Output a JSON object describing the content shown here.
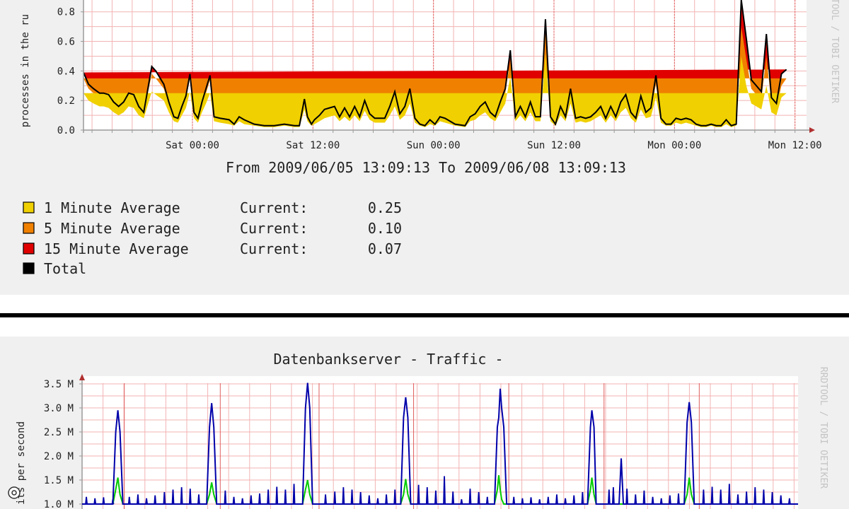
{
  "colors": {
    "panel_bg": "#f0f0f0",
    "plot_bg": "#ffffff",
    "grid": "#f3b3b3",
    "axis": "#9a9a9a",
    "arrow": "#b03030",
    "text": "#222222",
    "watermark": "#c4c4c4",
    "divider": "#000000",
    "load_1min": "#f0d000",
    "load_5min": "#f08000",
    "load_15min": "#e00000",
    "load_total": "#000000",
    "traffic_out": "#0000aa",
    "traffic_in": "#00cc00"
  },
  "load_panel": {
    "ylabel_visible": "processes in the ru",
    "watermark": "RRDTOOL / TOBI OETIKER",
    "period_text": "From 2009/06/05 13:09:13 To 2009/06/08 13:09:13",
    "legend": [
      {
        "label": "1 Minute Average",
        "current_label": "Current:",
        "current_value": "0.25",
        "color": "#f0d000"
      },
      {
        "label": "5 Minute Average",
        "current_label": "Current:",
        "current_value": "0.10",
        "color": "#f08000"
      },
      {
        "label": "15 Minute Average",
        "current_label": "Current:",
        "current_value": "0.07",
        "color": "#e00000"
      },
      {
        "label": "Total",
        "current_label": "",
        "current_value": "",
        "color": "#000000"
      }
    ]
  },
  "traffic_panel": {
    "title": "Datenbankserver - Traffic -",
    "ylabel_visible": "its per second",
    "watermark": "RRDTOOL / TOBI OETIKER"
  },
  "chart_data": [
    {
      "type": "area",
      "xlabel": "",
      "ylabel": "processes in the ru",
      "x_ticks": [
        "Sat 00:00",
        "Sat 12:00",
        "Sun 00:00",
        "Sun 12:00",
        "Mon 00:00",
        "Mon 12:00"
      ],
      "x_tick_hours": [
        10.85,
        22.85,
        34.85,
        46.85,
        58.85,
        70.85
      ],
      "xlim_hours": [
        0,
        72
      ],
      "y_ticks": [
        "0.0",
        "0.2",
        "0.4",
        "0.6",
        "0.8"
      ],
      "ylim": [
        0,
        0.88
      ],
      "x_hours": [
        0,
        0.5,
        1,
        1.6,
        2,
        2.5,
        3,
        3.5,
        4,
        4.5,
        5,
        5.5,
        6,
        6.8,
        7.2,
        8,
        8.5,
        9,
        9.4,
        9.8,
        10.2,
        10.6,
        11,
        11.4,
        11.8,
        12.2,
        12.6,
        13,
        13.6,
        14.5,
        15,
        15.5,
        16,
        17,
        18,
        19,
        20,
        21,
        21.5,
        22,
        22.3,
        22.7,
        23,
        23.5,
        24,
        24.5,
        25,
        25.5,
        26,
        26.5,
        27,
        27.5,
        28,
        28.5,
        29,
        29.5,
        30,
        30.5,
        31,
        31.5,
        32,
        32.5,
        33,
        33.5,
        34,
        34.5,
        35,
        35.5,
        36,
        37,
        38,
        38.5,
        39,
        39.5,
        40,
        40.5,
        41,
        41.5,
        42,
        42.5,
        43,
        43.5,
        44,
        44.5,
        45,
        45.5,
        46,
        46.5,
        47,
        47.5,
        48,
        48.5,
        49,
        49.5,
        50,
        50.5,
        51,
        51.5,
        52,
        52.5,
        53,
        53.5,
        54,
        54.5,
        55,
        55.5,
        56,
        56.5,
        57,
        57.5,
        58,
        58.5,
        59,
        59.5,
        60,
        60.5,
        61,
        61.5,
        62,
        62.5,
        63,
        63.5,
        64,
        64.5,
        65,
        65.5,
        66,
        66.5,
        67,
        67.5,
        68,
        68.5,
        69,
        69.5,
        70,
        70.5,
        71,
        71.5,
        72
      ],
      "series": [
        {
          "name": "1 Minute Average",
          "values": [
            0.25,
            0.2,
            0.18,
            0.16,
            0.16,
            0.15,
            0.12,
            0.1,
            0.12,
            0.16,
            0.15,
            0.1,
            0.08,
            0.26,
            0.24,
            0.2,
            0.12,
            0.06,
            0.05,
            0.1,
            0.15,
            0.26,
            0.08,
            0.05,
            0.12,
            0.18,
            0.25,
            0.06,
            0.05,
            0.04,
            0.03,
            0.06,
            0.04,
            0.03,
            0.02,
            0.02,
            0.03,
            0.02,
            0.02,
            0.14,
            0.06,
            0.03,
            0.04,
            0.06,
            0.08,
            0.09,
            0.1,
            0.06,
            0.09,
            0.06,
            0.1,
            0.06,
            0.13,
            0.07,
            0.05,
            0.05,
            0.05,
            0.1,
            0.16,
            0.07,
            0.1,
            0.18,
            0.05,
            0.03,
            0.02,
            0.04,
            0.03,
            0.06,
            0.05,
            0.03,
            0.02,
            0.06,
            0.07,
            0.1,
            0.12,
            0.08,
            0.06,
            0.12,
            0.18,
            0.36,
            0.06,
            0.1,
            0.06,
            0.12,
            0.06,
            0.06,
            0.52,
            0.06,
            0.03,
            0.1,
            0.06,
            0.18,
            0.05,
            0.06,
            0.05,
            0.06,
            0.08,
            0.1,
            0.05,
            0.1,
            0.06,
            0.12,
            0.15,
            0.08,
            0.05,
            0.14,
            0.08,
            0.09,
            0.22,
            0.05,
            0.03,
            0.03,
            0.05,
            0.04,
            0.05,
            0.04,
            0.03,
            0.02,
            0.02,
            0.03,
            0.02,
            0.02,
            0.04,
            0.02,
            0.03,
            0.5,
            0.3,
            0.18,
            0.16,
            0.14,
            0.3,
            0.12,
            0.1,
            0.22,
            0.25
          ]
        },
        {
          "name": "5 Minute Average",
          "values": [
            0.1,
            0.08,
            0.07,
            0.06,
            0.06,
            0.06,
            0.05,
            0.04,
            0.05,
            0.06,
            0.06,
            0.04,
            0.03,
            0.12,
            0.11,
            0.08,
            0.05,
            0.02,
            0.02,
            0.04,
            0.06,
            0.09,
            0.03,
            0.02,
            0.05,
            0.07,
            0.09,
            0.02,
            0.02,
            0.02,
            0.01,
            0.02,
            0.02,
            0.01,
            0.01,
            0.01,
            0.01,
            0.01,
            0.01,
            0.05,
            0.02,
            0.01,
            0.02,
            0.03,
            0.04,
            0.04,
            0.04,
            0.02,
            0.04,
            0.02,
            0.04,
            0.02,
            0.05,
            0.03,
            0.02,
            0.02,
            0.02,
            0.04,
            0.07,
            0.03,
            0.04,
            0.07,
            0.02,
            0.01,
            0.01,
            0.02,
            0.01,
            0.02,
            0.02,
            0.01,
            0.01,
            0.02,
            0.03,
            0.04,
            0.05,
            0.03,
            0.02,
            0.05,
            0.07,
            0.12,
            0.02,
            0.04,
            0.02,
            0.05,
            0.02,
            0.02,
            0.15,
            0.02,
            0.01,
            0.04,
            0.02,
            0.07,
            0.02,
            0.02,
            0.02,
            0.02,
            0.03,
            0.04,
            0.02,
            0.04,
            0.02,
            0.05,
            0.06,
            0.03,
            0.02,
            0.06,
            0.03,
            0.04,
            0.09,
            0.02,
            0.01,
            0.01,
            0.02,
            0.02,
            0.02,
            0.02,
            0.01,
            0.01,
            0.01,
            0.01,
            0.01,
            0.01,
            0.02,
            0.01,
            0.01,
            0.2,
            0.18,
            0.1,
            0.08,
            0.07,
            0.2,
            0.06,
            0.05,
            0.08,
            0.1
          ]
        },
        {
          "name": "15 Minute Average",
          "values": [
            0.04,
            0.03,
            0.03,
            0.03,
            0.03,
            0.03,
            0.02,
            0.02,
            0.02,
            0.03,
            0.03,
            0.02,
            0.01,
            0.05,
            0.05,
            0.03,
            0.02,
            0.01,
            0.01,
            0.02,
            0.02,
            0.03,
            0.01,
            0.01,
            0.02,
            0.03,
            0.03,
            0.01,
            0.01,
            0.01,
            0.0,
            0.01,
            0.01,
            0.0,
            0.0,
            0.0,
            0.0,
            0.0,
            0.0,
            0.02,
            0.01,
            0.0,
            0.01,
            0.01,
            0.02,
            0.02,
            0.02,
            0.01,
            0.02,
            0.01,
            0.02,
            0.01,
            0.02,
            0.01,
            0.01,
            0.01,
            0.01,
            0.02,
            0.03,
            0.01,
            0.02,
            0.03,
            0.01,
            0.0,
            0.0,
            0.01,
            0.0,
            0.01,
            0.01,
            0.0,
            0.0,
            0.01,
            0.01,
            0.02,
            0.02,
            0.01,
            0.01,
            0.02,
            0.03,
            0.06,
            0.01,
            0.02,
            0.01,
            0.02,
            0.01,
            0.01,
            0.08,
            0.01,
            0.0,
            0.02,
            0.01,
            0.03,
            0.01,
            0.01,
            0.01,
            0.01,
            0.01,
            0.02,
            0.01,
            0.02,
            0.01,
            0.02,
            0.03,
            0.01,
            0.01,
            0.03,
            0.01,
            0.02,
            0.06,
            0.01,
            0.0,
            0.0,
            0.01,
            0.01,
            0.01,
            0.01,
            0.0,
            0.0,
            0.0,
            0.0,
            0.0,
            0.0,
            0.01,
            0.0,
            0.0,
            0.18,
            0.14,
            0.06,
            0.06,
            0.05,
            0.15,
            0.04,
            0.03,
            0.08,
            0.06
          ]
        }
      ]
    },
    {
      "type": "line",
      "title": "Datenbankserver - Traffic -",
      "ylabel": "its per second",
      "y_ticks": [
        "1.0 M",
        "1.5 M",
        "2.0 M",
        "2.5 M",
        "3.0 M",
        "3.5 M"
      ],
      "ylim": [
        1.0,
        3.5
      ],
      "xlim": [
        0,
        100
      ],
      "x": [
        0,
        4.3,
        4.7,
        5,
        5.3,
        5.7,
        6,
        17.4,
        17.8,
        18.1,
        18.4,
        18.8,
        19.1,
        30.8,
        31.2,
        31.5,
        31.8,
        32.2,
        32.5,
        44.5,
        44.9,
        45.2,
        45.5,
        45.9,
        46.2,
        57.6,
        58,
        58.2,
        58.4,
        58.6,
        58.9,
        59.3,
        70.6,
        71,
        71.2,
        71.5,
        71.8,
        72.1,
        75,
        75.3,
        75.6,
        84.1,
        84.5,
        84.8,
        85.1,
        85.5,
        85.8,
        100
      ],
      "series": [
        {
          "name": "",
          "values": [
            1.0,
            1.0,
            2.5,
            2.95,
            2.5,
            1.0,
            1.0,
            1.0,
            2.6,
            3.1,
            2.6,
            1.0,
            1.0,
            1.0,
            3.0,
            3.52,
            3.0,
            1.0,
            1.0,
            1.0,
            2.8,
            3.22,
            2.8,
            1.0,
            1.0,
            1.0,
            2.6,
            2.8,
            3.4,
            3.0,
            2.6,
            1.0,
            1.0,
            2.6,
            2.95,
            2.6,
            1.0,
            1.0,
            1.0,
            1.95,
            1.0,
            1.0,
            2.7,
            3.12,
            2.7,
            1.0,
            1.0,
            1.0
          ]
        },
        {
          "name": "",
          "values": [
            1.0,
            1.0,
            1.3,
            1.55,
            1.2,
            1.0,
            1.0,
            1.0,
            1.2,
            1.45,
            1.2,
            1.0,
            1.0,
            1.0,
            1.3,
            1.5,
            1.2,
            1.0,
            1.0,
            1.0,
            1.2,
            1.52,
            1.2,
            1.0,
            1.0,
            1.0,
            1.3,
            1.6,
            1.3,
            1.1,
            1.0,
            1.0,
            1.0,
            1.3,
            1.55,
            1.2,
            1.0,
            1.0,
            1.0,
            1.0,
            1.0,
            1.0,
            1.2,
            1.55,
            1.2,
            1.0,
            1.0,
            1.0
          ]
        }
      ]
    }
  ]
}
